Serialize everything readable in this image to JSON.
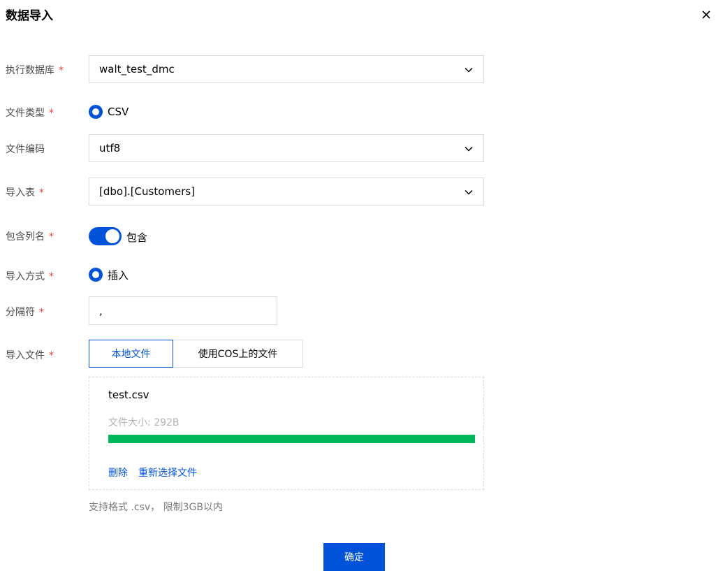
{
  "dialog": {
    "title": "数据导入"
  },
  "form": {
    "required_mark": "*",
    "database": {
      "label": "执行数据库",
      "value": "walt_test_dmc"
    },
    "file_type": {
      "label": "文件类型",
      "option": "CSV"
    },
    "encoding": {
      "label": "文件编码",
      "value": "utf8"
    },
    "table": {
      "label": "导入表",
      "value": "[dbo].[Customers]"
    },
    "header": {
      "label": "包含列名",
      "switch_text": "包含",
      "on": true
    },
    "mode": {
      "label": "导入方式",
      "option": "插入"
    },
    "delimiter": {
      "label": "分隔符",
      "value": ","
    },
    "file": {
      "label": "导入文件",
      "tabs": [
        "本地文件",
        "使用COS上的文件"
      ],
      "active_tab": "本地文件",
      "file_name": "test.csv",
      "file_size": "文件大小: 292B",
      "progress": 100,
      "delete_label": "删除",
      "reselect_label": "重新选择文件",
      "hint": "支持格式 .csv， 限制3GB以内"
    }
  },
  "footer": {
    "confirm_label": "确定"
  },
  "colors": {
    "primary": "#0052d9",
    "success": "#00b85c",
    "required": "#e54545"
  }
}
